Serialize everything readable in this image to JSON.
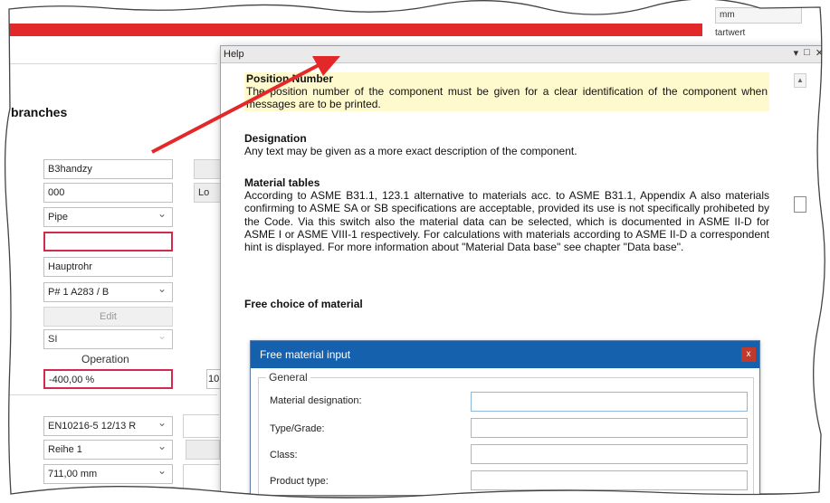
{
  "app": {
    "heading": "branches",
    "top_right": {
      "unit": "mm",
      "startwert": "tartwert"
    },
    "fields": [
      {
        "value": "B3handzy"
      },
      {
        "value": "000"
      },
      {
        "value": "Pipe"
      },
      {
        "value": ""
      },
      {
        "value": "Hauptrohr"
      },
      {
        "value": "P# 1 A283 / B"
      }
    ],
    "edit_label": "Edit",
    "unit_system": "SI",
    "operation_label": "Operation",
    "operation_value": "-400,00 %",
    "small_btn_1": "",
    "small_btn_2": "Lo",
    "side_value": "10",
    "lower_fields": [
      {
        "value": "EN10216-5   12/13 R"
      },
      {
        "value": "Reihe 1"
      },
      {
        "value": "711,00 mm"
      }
    ]
  },
  "help": {
    "window_title": "Help",
    "controls": [
      "▾",
      "□",
      "✕"
    ],
    "topics": [
      {
        "title": "Position Number",
        "text": "The position number of the component must be given for a clear identification of the component when messages are to be printed.",
        "highlight": true
      },
      {
        "title": "Designation",
        "text": "Any text may be given as a more exact description of the component."
      },
      {
        "title": "Material tables",
        "text": "According to ASME B31.1, 123.1 alternative to materials acc. to ASME B31.1, Appendix A also materials confirming to ASME SA or SB specifications are acceptable, provided its use is not specifically prohibeted by the Code. Via this switch also the material data can be selected, which is documented in ASME II-D for ASME I or ASME VIII-1 respectively. For calculations with materials according to ASME II-D a correspondent hint is displayed. For more information about \"Material Data base\" see chapter \"Data base\"."
      },
      {
        "title": "Free choice of material",
        "text": ""
      }
    ]
  },
  "material_dialog": {
    "title": "Free material input",
    "close": "x",
    "group_label": "General",
    "fields": [
      {
        "label": "Material designation:",
        "value": ""
      },
      {
        "label": "Type/Grade:",
        "value": ""
      },
      {
        "label": "Class:",
        "value": ""
      },
      {
        "label": "Product type:",
        "value": ""
      }
    ]
  },
  "colors": {
    "annotation": "#e3282a",
    "dialog_titlebar": "#1561ad",
    "highlight": "#fffacd",
    "error_border": "#d32b4f"
  }
}
